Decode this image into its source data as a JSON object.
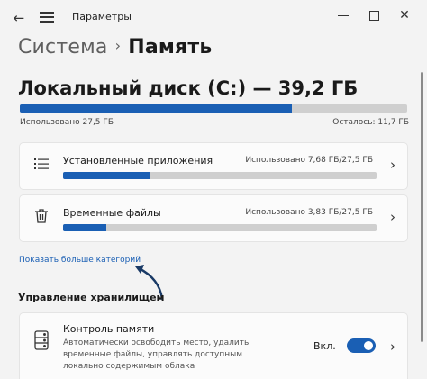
{
  "window": {
    "title": "Параметры"
  },
  "breadcrumb": {
    "parent": "Система",
    "separator": "›",
    "current": "Память"
  },
  "disk": {
    "title": "Локальный диск (C:) — 39,2 ГБ",
    "used_label": "Использовано 27,5 ГБ",
    "free_label": "Осталось: 11,7 ГБ",
    "used_fraction": 0.702
  },
  "categories": [
    {
      "label": "Установленные приложения",
      "value": "Использовано 7,68 ГБ/27,5 ГБ",
      "fraction": 0.279,
      "icon": "apps-list-icon"
    },
    {
      "label": "Временные файлы",
      "value": "Использовано 3,83 ГБ/27,5 ГБ",
      "fraction": 0.139,
      "icon": "trash-icon"
    }
  ],
  "more_link": "Показать больше категорий",
  "management": {
    "title": "Управление хранилищем",
    "storage_sense": {
      "title": "Контроль памяти",
      "description": "Автоматически освободить место, удалить временные файлы, управлять доступным локально содержимым облака",
      "state_label": "Вкл.",
      "enabled": true
    }
  },
  "colors": {
    "accent": "#1a5fb4",
    "bar_track": "#cfcfcf",
    "annotation_arrow": "#1a3a66"
  }
}
